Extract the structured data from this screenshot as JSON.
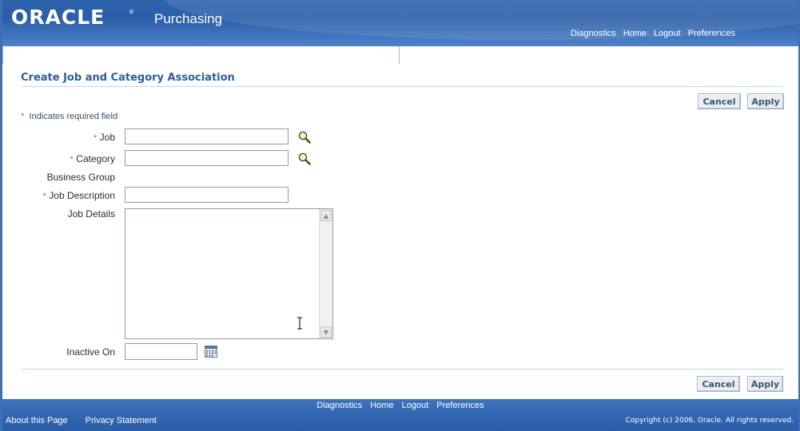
{
  "header": {
    "logo": "ORACLE",
    "logo_mark": "®",
    "app_title": "Purchasing",
    "global_links": [
      "Diagnostics",
      "Home",
      "Logout",
      "Preferences"
    ]
  },
  "page": {
    "title": "Create Job and Category Association",
    "required_note": "Indicates required field",
    "required_marker": "*"
  },
  "buttons": {
    "cancel": "Cancel",
    "apply": "Apply"
  },
  "form": {
    "job": {
      "label": "Job",
      "value": ""
    },
    "category": {
      "label": "Category",
      "value": ""
    },
    "business_group": {
      "label": "Business Group"
    },
    "job_description": {
      "label": "Job Description",
      "value": ""
    },
    "job_details": {
      "label": "Job Details",
      "value": ""
    },
    "inactive_on": {
      "label": "Inactive On",
      "value": ""
    }
  },
  "footer": {
    "links": [
      "Diagnostics",
      "Home",
      "Logout",
      "Preferences"
    ],
    "about": "About this Page",
    "privacy": "Privacy Statement",
    "copyright": "Copyright (c) 2006, Oracle. All rights reserved."
  },
  "colors": {
    "brand_blue": "#2e63ad",
    "title_blue": "#2d5d94",
    "required_star": "#5f88b8"
  },
  "icons": {
    "job_lov": "search-icon",
    "category_lov": "search-icon",
    "inactive_date": "calendar-icon"
  }
}
